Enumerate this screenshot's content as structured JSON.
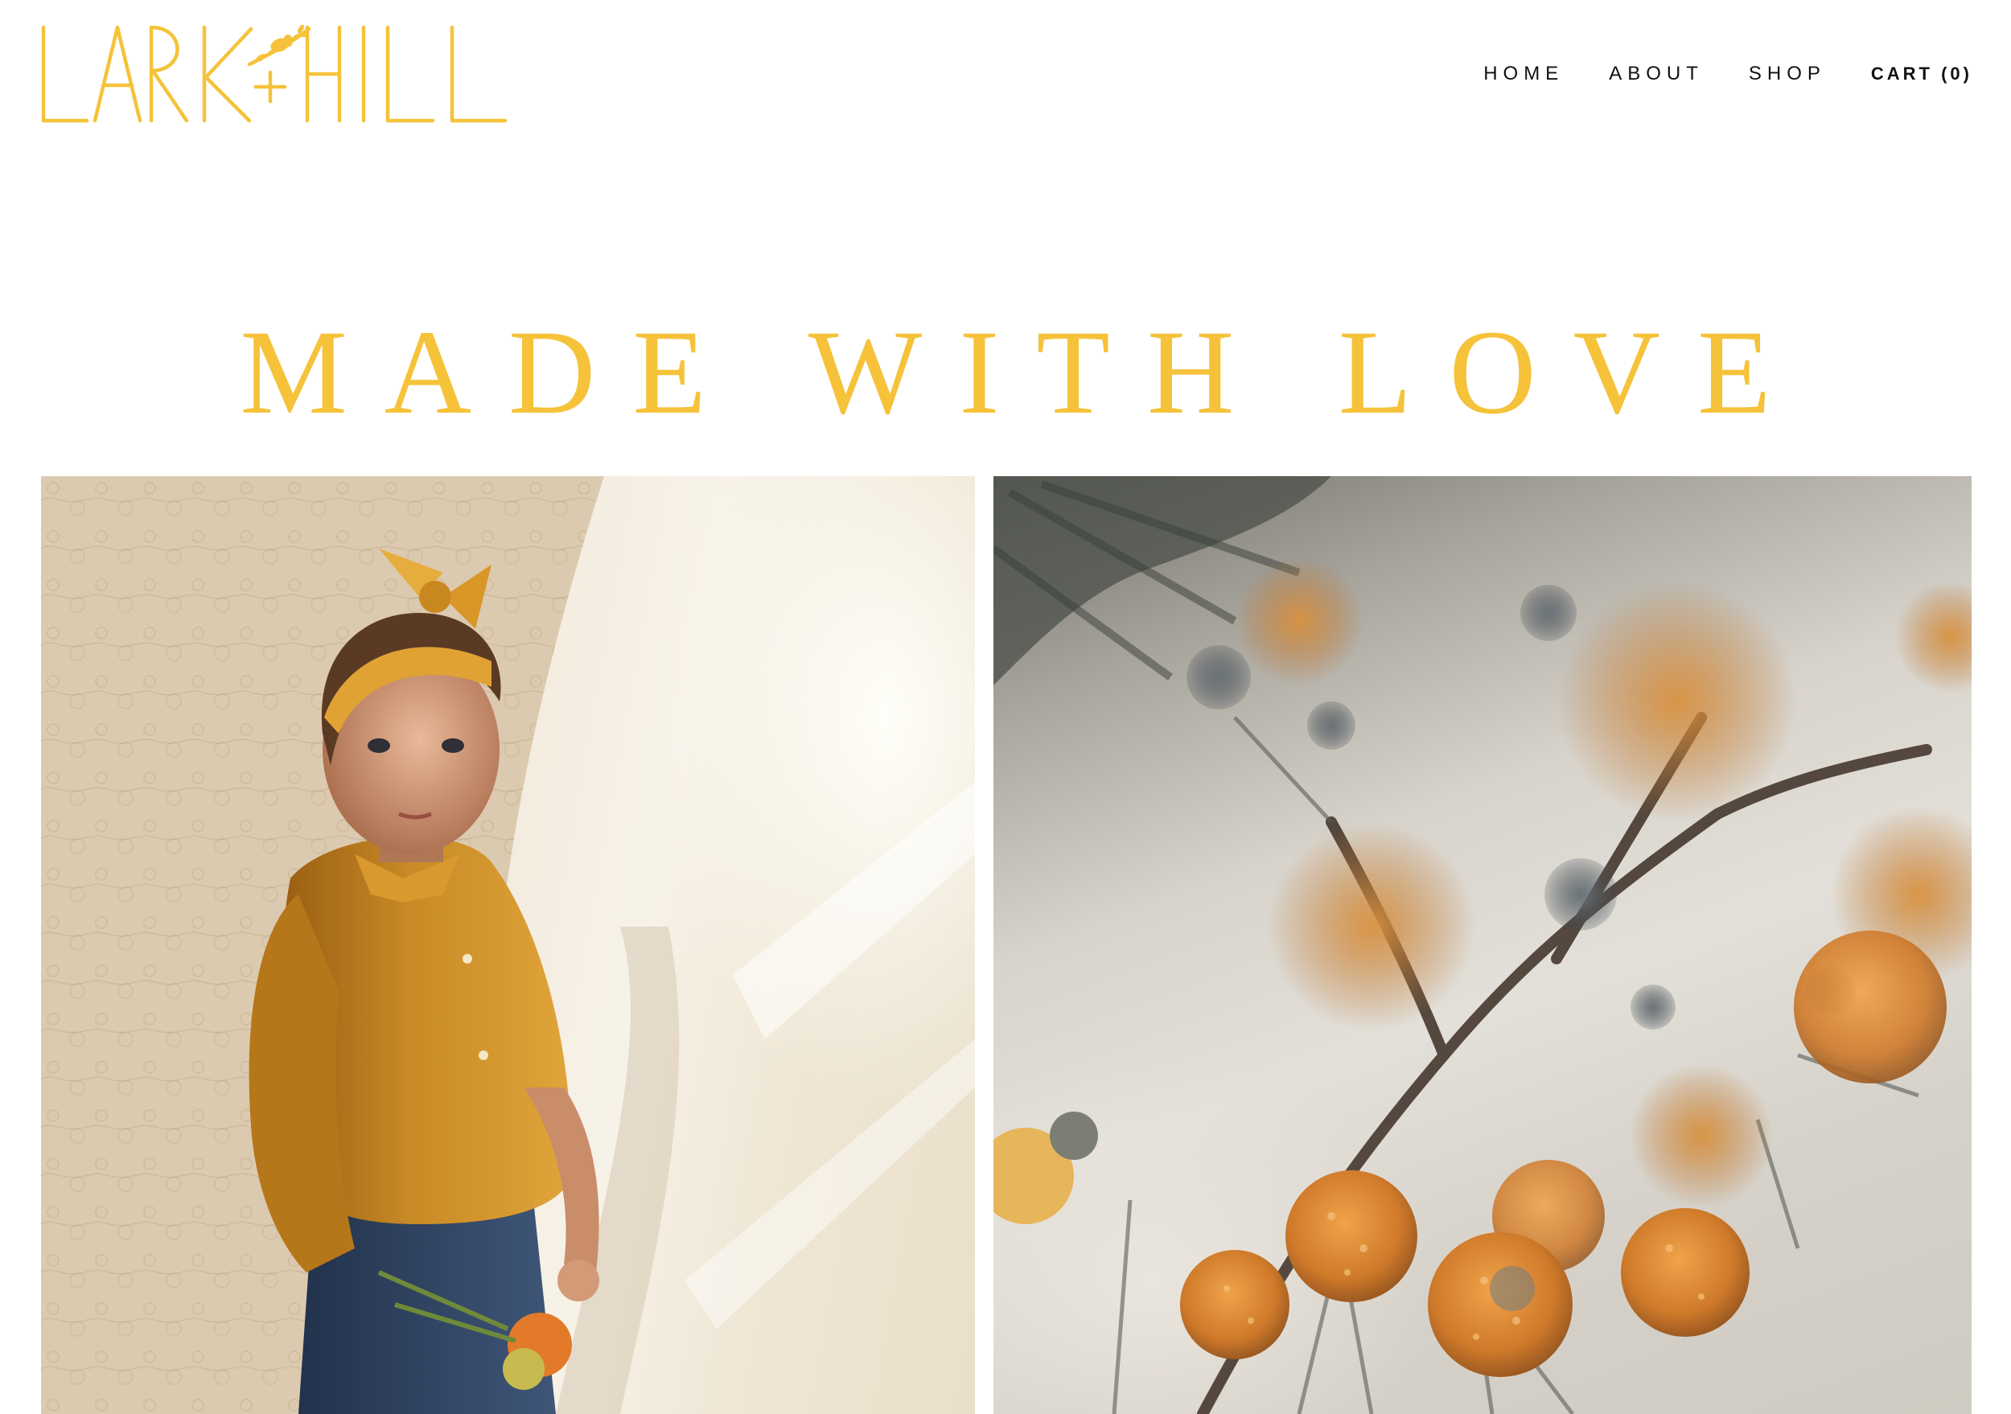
{
  "brand": {
    "name": "LARK HILL",
    "color": "#f5c23a"
  },
  "nav": {
    "items": [
      {
        "label": "HOME"
      },
      {
        "label": "ABOUT"
      },
      {
        "label": "SHOP"
      },
      {
        "label": "CART (0)"
      }
    ]
  },
  "hero": {
    "title": "MADE WITH LOVE"
  },
  "gallery": {
    "images": [
      {
        "subject": "child-portrait"
      },
      {
        "subject": "dried-flowers"
      }
    ]
  }
}
